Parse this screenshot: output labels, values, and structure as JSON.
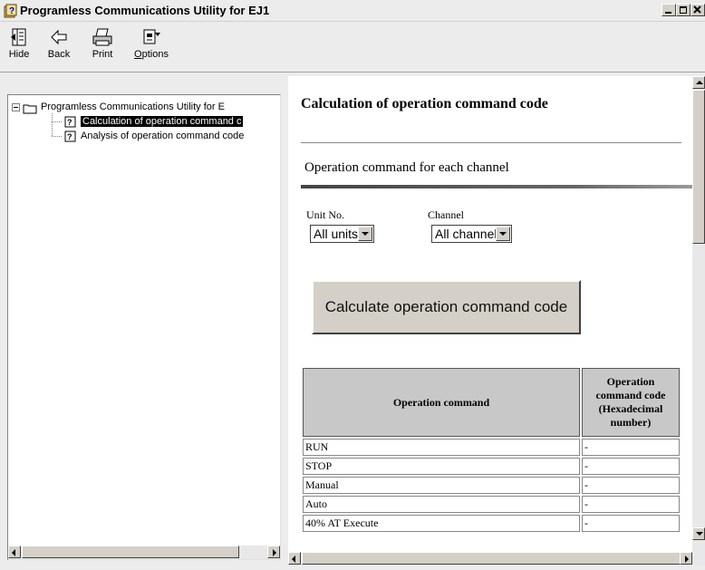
{
  "window": {
    "title": "Programless Communications Utility for EJ1"
  },
  "toolbar": {
    "hide_label": "Hide",
    "back_label": "Back",
    "print_label": "Print",
    "options_label": "Options"
  },
  "tree": {
    "root_label": "Programless Communications Utility for E",
    "items": [
      {
        "label": "Calculation of operation command c",
        "selected": true
      },
      {
        "label": "Analysis of operation command code",
        "selected": false
      }
    ]
  },
  "content": {
    "title": "Calculation of operation command code",
    "subtitle": "Operation command for each channel",
    "unit_label": "Unit No.",
    "unit_value": "All units",
    "channel_label": "Channel",
    "channel_value": "All channels",
    "calc_button": "Calculate operation command code",
    "table": {
      "headers": [
        "Operation command",
        "Operation command code (Hexadecimal number)"
      ],
      "rows": [
        [
          "RUN",
          "-"
        ],
        [
          "STOP",
          "-"
        ],
        [
          "Manual",
          "-"
        ],
        [
          "Auto",
          "-"
        ],
        [
          "40% AT Execute",
          "-"
        ]
      ]
    }
  }
}
